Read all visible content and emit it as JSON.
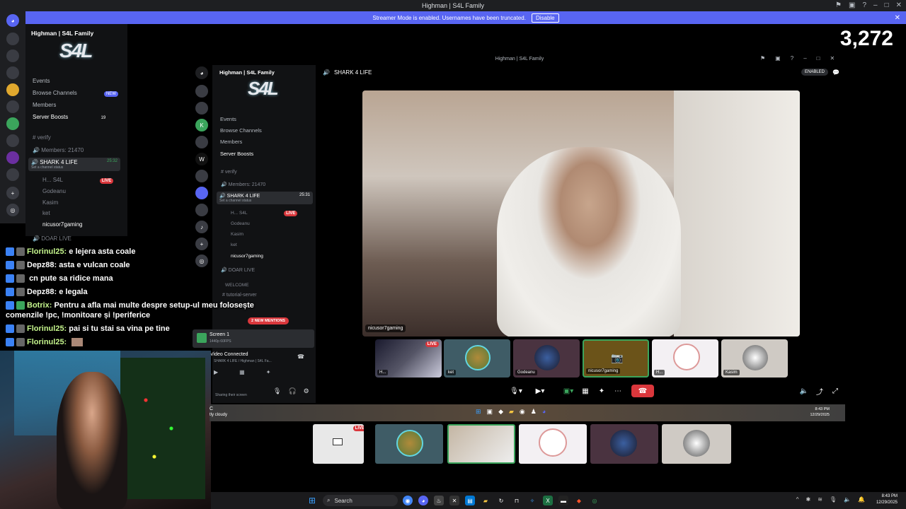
{
  "titlebar": {
    "title": "Highman | S4L Family"
  },
  "streamer_bar": {
    "message": "Streamer Mode is enabled. Usernames have been truncated.",
    "disable_label": "Disable"
  },
  "viewer_count": "3,272",
  "rail_badges": [
    "129",
    "52",
    "12",
    "20",
    "1",
    "11",
    "24",
    "97",
    "341"
  ],
  "outer_sidebar": {
    "server_name": "Highman | S4L Family",
    "logo_text": "S4L",
    "menu": [
      "Events",
      "Browse Channels",
      "Members",
      "Server Boosts"
    ],
    "new_badge": "NEW",
    "boost_count": "19",
    "channels": {
      "verify": "verify",
      "members": "Members: 21470",
      "voice": "SHARK 4 LIFE",
      "voice_time": "25:32",
      "status": "Set a channel status",
      "users": [
        "H...",
        "Godeanu",
        "Kasim",
        "ket",
        "nicusor7gaming"
      ],
      "user_tag": "S4L",
      "live": "LIVE",
      "next": "DOAR LIVE",
      "welcome": "WELCOME"
    }
  },
  "chat": [
    {
      "user": "Florinul25:",
      "msg": "e lejera asta coale"
    },
    {
      "user": "Depz88:",
      "msg": "asta e vulcan coale"
    },
    {
      "user": "",
      "msg": "cn pute sa ridice mana"
    },
    {
      "user": "Depz88:",
      "msg": "e legala"
    },
    {
      "user": "Botrix:",
      "msg": "Pentru a afla mai multe despre setup-ul meu folosește"
    },
    {
      "user": "",
      "msg": "comenzile !pc, !monitoare și !periferice"
    },
    {
      "user": "Florinul25:",
      "msg": "pai si tu stai sa vina pe tine"
    },
    {
      "user": "Florinul25:",
      "msg": ""
    }
  ],
  "inner": {
    "window_title": "Highman | S4L Family",
    "header_channel": "SHARK 4 LIFE",
    "enabled_badge": "ENABLED",
    "server_name": "Highman | S4L Family",
    "menu": [
      "Events",
      "Browse Channels",
      "Members",
      "Server Boosts"
    ],
    "verify": "verify",
    "members": "Members: 21470",
    "voice": "SHARK 4 LIFE",
    "voice_time": "25:31",
    "status": "Set a channel status",
    "users": [
      "H...",
      "Godeanu",
      "Kasim",
      "ket",
      "nicusor7gaming"
    ],
    "user_tag": "S4L",
    "live": "LIVE",
    "doar": "DOAR LIVE",
    "welcome": "WELCOME",
    "tutorial": "tutorial-server",
    "announcement": "anunturi",
    "mentions": "2 NEW MENTIONS",
    "screen_label": "Screen 1",
    "screen_sub": "1440p 60FPS",
    "voice_connected": "Video Connected",
    "voice_sub": "SHARK 4 LIFE / Highman | S4L Fa...",
    "sharing": "Sharing their screen",
    "rail_badges": [
      "441",
      "14"
    ]
  },
  "video": {
    "main_caption": "nicusor7gaming"
  },
  "tiles": [
    {
      "caption": "H...",
      "live": "LIVE"
    },
    {
      "caption": "ket"
    },
    {
      "caption": "Godeanu"
    },
    {
      "caption": "nicusor7gaming"
    },
    {
      "caption": "H..."
    },
    {
      "caption": "Kasim"
    }
  ],
  "inner_taskbar": {
    "weather": "C",
    "weather_sub": "tly cloudy",
    "time": "8:43 PM",
    "date": "12/29/2025"
  },
  "taskbar": {
    "search_placeholder": "Search",
    "time": "8:43 PM",
    "date": "12/29/2025"
  },
  "colors": {
    "accent": "#5865f2",
    "live": "#da373c",
    "chat_user": "#c6f68d"
  }
}
